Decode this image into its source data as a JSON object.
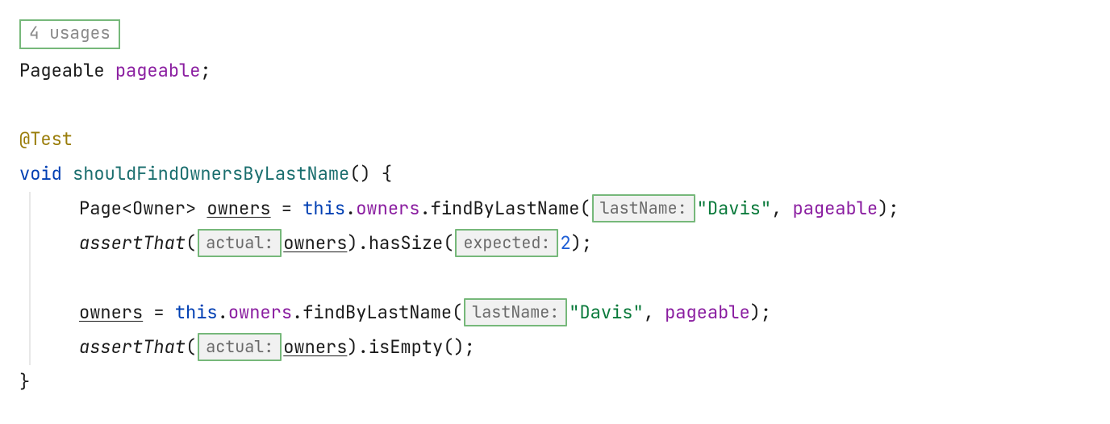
{
  "usages": "4 usages",
  "decl": {
    "type": "Pageable",
    "name": "pageable",
    "semi": ";"
  },
  "annotation": "@Test",
  "sig": {
    "kw": "void",
    "name": "shouldFindOwnersByLastName",
    "parens": "()",
    "brace": " {"
  },
  "l1": {
    "pageType": "Page<Owner> ",
    "owners": "owners",
    "eq": " = ",
    "this": "this",
    "dot1": ".",
    "ownersField": "owners",
    "dot2": ".",
    "find": "findByLastName",
    "open": "(",
    "hintLastName": "lastName:",
    "davis": "\"Davis\"",
    "comma": ", ",
    "pageable": "pageable",
    "close": ");"
  },
  "l2": {
    "assert": "assertThat",
    "open": "(",
    "hintActual": "actual:",
    "owners": "owners",
    "mid": ").",
    "hasSize": "hasSize",
    "open2": "(",
    "hintExpected": "expected:",
    "two": "2",
    "close": ");"
  },
  "l3": {
    "owners": "owners",
    "eq": " = ",
    "this": "this",
    "dot1": ".",
    "ownersField": "owners",
    "dot2": ".",
    "find": "findByLastName",
    "open": "(",
    "hintLastName": "lastName:",
    "davis": "\"Davis\"",
    "comma": ", ",
    "pageable": "pageable",
    "close": ");"
  },
  "l4": {
    "assert": "assertThat",
    "open": "(",
    "hintActual": "actual:",
    "owners": "owners",
    "mid": ").",
    "isEmpty": "isEmpty",
    "close": "();"
  },
  "closeBrace": "}"
}
